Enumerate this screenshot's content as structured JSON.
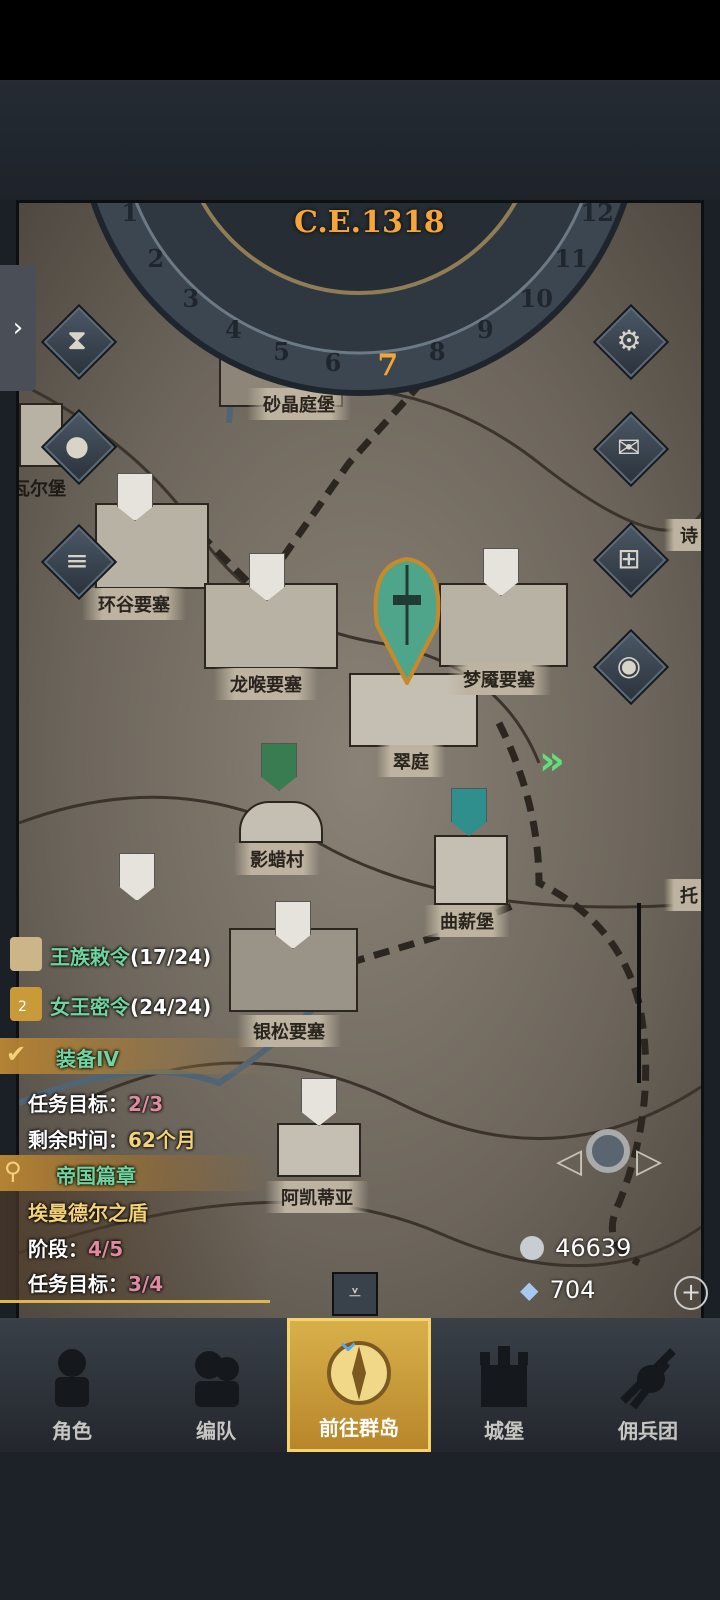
{
  "calendar": {
    "era": "C.E.1318",
    "months": [
      "1",
      "2",
      "3",
      "4",
      "5",
      "6",
      "7",
      "8",
      "9",
      "10",
      "11",
      "12"
    ],
    "current_month": "7"
  },
  "locations": {
    "shajing": "砂晶庭堡",
    "waer": "瓦尔堡",
    "huangu": "环谷要塞",
    "longhou": "龙喉要塞",
    "mengyan": "梦魇要塞",
    "cuiting": "翠庭",
    "yinglacun": "影蜡村",
    "quxin": "曲薪堡",
    "yinsong": "银松要塞",
    "akaidiya": "阿凯蒂亚",
    "tuo": "托",
    "shi": "诗"
  },
  "quests": {
    "royal_decree": {
      "title": "王族敕令",
      "progress": "(17/24)"
    },
    "queen_order": {
      "title": "女王密令",
      "progress": "(24/24)",
      "badge": "2"
    },
    "equipment": {
      "title": "装备IV",
      "goal_label": "任务目标：",
      "goal_value": "2/3",
      "time_label": "剩余时间：",
      "time_value": "62个月"
    },
    "empire": {
      "title": "帝国篇章",
      "subtitle": "埃曼德尔之盾",
      "stage_label": "阶段：",
      "stage_value": "4/5",
      "goal_label": "任务目标：",
      "goal_value": "3/4"
    }
  },
  "resources": {
    "silver": "46639",
    "crystal": "704"
  },
  "side_buttons": [
    "hourglass-icon",
    "money-bag-icon",
    "scroll-icon",
    "gear-icon",
    "mail-icon",
    "map-grid-icon",
    "coin-icon"
  ],
  "nav": [
    {
      "label": "角色"
    },
    {
      "label": "编队"
    },
    {
      "label": "前往群岛"
    },
    {
      "label": "城堡"
    },
    {
      "label": "佣兵团"
    }
  ],
  "colors": {
    "accent_gold": "#f5a53a",
    "quest_green": "#6fd4a0",
    "progress_pink": "#e08aa0",
    "helmet_teal": "#4fa58a"
  }
}
